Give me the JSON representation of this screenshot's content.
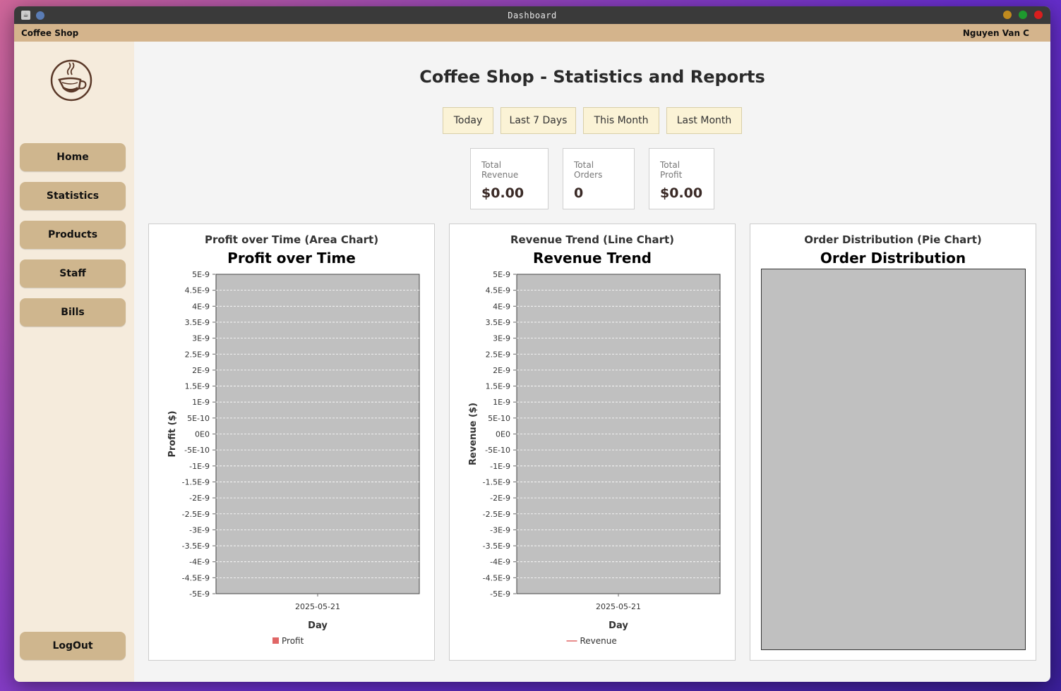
{
  "window": {
    "title": "Dashboard",
    "controls": {
      "minimize_color": "#c08a1e",
      "maximize_color": "#1e9a2e",
      "close_color": "#d91e1e"
    }
  },
  "menubar": {
    "app_name": "Coffee Shop",
    "user_name": "Nguyen Van C"
  },
  "sidebar": {
    "logo_icon": "coffee-cup-icon",
    "items": [
      {
        "label": "Home"
      },
      {
        "label": "Statistics"
      },
      {
        "label": "Products"
      },
      {
        "label": "Staff"
      },
      {
        "label": "Bills"
      }
    ],
    "logout_label": "LogOut"
  },
  "main": {
    "title": "Coffee Shop - Statistics and Reports",
    "periods": [
      "Today",
      "Last 7 Days",
      "This Month",
      "Last Month"
    ],
    "stats": [
      {
        "label": "Total Revenue",
        "value": "$0.00"
      },
      {
        "label": "Total Orders",
        "value": "0"
      },
      {
        "label": "Total Profit",
        "value": "$0.00"
      }
    ]
  },
  "colors": {
    "accent": "#cfb68e",
    "plot_bg": "#c0c0c0",
    "profit_series": "#e06666",
    "revenue_series": "#e06666"
  },
  "chart_data": [
    {
      "type": "area",
      "panel_caption": "Profit over Time (Area Chart)",
      "title": "Profit over Time",
      "xlabel": "Day",
      "ylabel": "Profit ($)",
      "x": [
        "2025-05-21"
      ],
      "series": [
        {
          "name": "Profit",
          "values": [
            0
          ]
        }
      ],
      "ylim": [
        -5e-09,
        5e-09
      ],
      "yticks": [
        "5E-9",
        "4.5E-9",
        "4E-9",
        "3.5E-9",
        "3E-9",
        "2.5E-9",
        "2E-9",
        "1.5E-9",
        "1E-9",
        "5E-10",
        "0E0",
        "-5E-10",
        "-1E-9",
        "-1.5E-9",
        "-2E-9",
        "-2.5E-9",
        "-3E-9",
        "-3.5E-9",
        "-4E-9",
        "-4.5E-9",
        "-5E-9"
      ],
      "grid": true,
      "legend": "bottom"
    },
    {
      "type": "line",
      "panel_caption": "Revenue Trend (Line Chart)",
      "title": "Revenue Trend",
      "xlabel": "Day",
      "ylabel": "Revenue ($)",
      "x": [
        "2025-05-21"
      ],
      "series": [
        {
          "name": "Revenue",
          "values": [
            0
          ]
        }
      ],
      "ylim": [
        -5e-09,
        5e-09
      ],
      "yticks": [
        "5E-9",
        "4.5E-9",
        "4E-9",
        "3.5E-9",
        "3E-9",
        "2.5E-9",
        "2E-9",
        "1.5E-9",
        "1E-9",
        "5E-10",
        "0E0",
        "-5E-10",
        "-1E-9",
        "-1.5E-9",
        "-2E-9",
        "-2.5E-9",
        "-3E-9",
        "-3.5E-9",
        "-4E-9",
        "-4.5E-9",
        "-5E-9"
      ],
      "grid": true,
      "legend": "bottom"
    },
    {
      "type": "pie",
      "panel_caption": "Order Distribution (Pie Chart)",
      "title": "Order Distribution",
      "categories": [],
      "values": []
    }
  ]
}
